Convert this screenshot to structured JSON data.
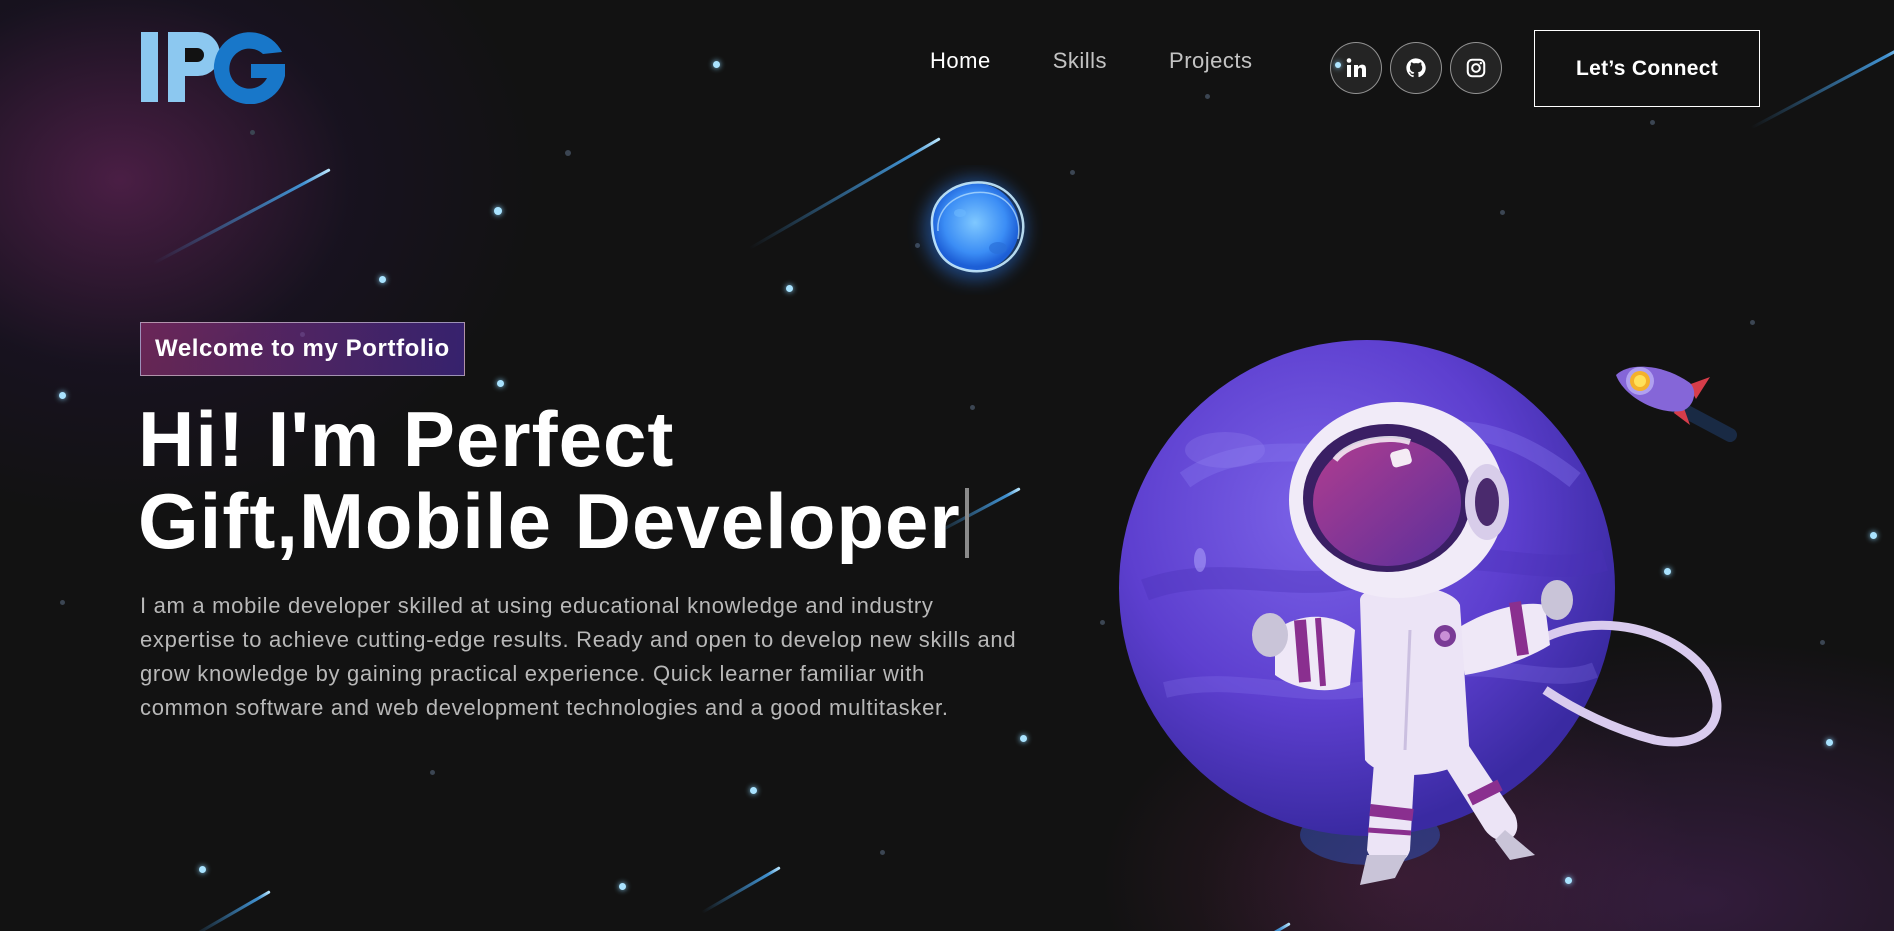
{
  "brand": {
    "logo_text": "IPG",
    "colors": {
      "light_blue": "#8cc8f0",
      "deep_blue": "#1877c9"
    }
  },
  "nav": {
    "links": [
      {
        "label": "Home",
        "active": true
      },
      {
        "label": "Skills",
        "active": false
      },
      {
        "label": "Projects",
        "active": false
      }
    ],
    "social": [
      {
        "icon": "linkedin-icon",
        "glyph": "in"
      },
      {
        "icon": "github-icon"
      },
      {
        "icon": "instagram-icon"
      }
    ],
    "cta_label": "Let’s Connect"
  },
  "hero": {
    "tagline": "Welcome to my Portfolio",
    "headline_line1": "Hi! I'm Perfect",
    "headline_line2": "Gift,Mobile Developer",
    "bio": "I am a mobile developer skilled at using educational knowledge and industry expertise to achieve cutting-edge results. Ready and open to develop new skills and grow knowledge by gaining practical experience. Quick learner familiar with common software and web development technologies and a good multitasker."
  },
  "illustration": {
    "subjects": [
      "planet",
      "astronaut",
      "rocket",
      "glowing-moon"
    ],
    "colors": {
      "planet": "#6a46d6",
      "suit": "#e8e0f4",
      "visor": "#8a2f8f"
    }
  }
}
